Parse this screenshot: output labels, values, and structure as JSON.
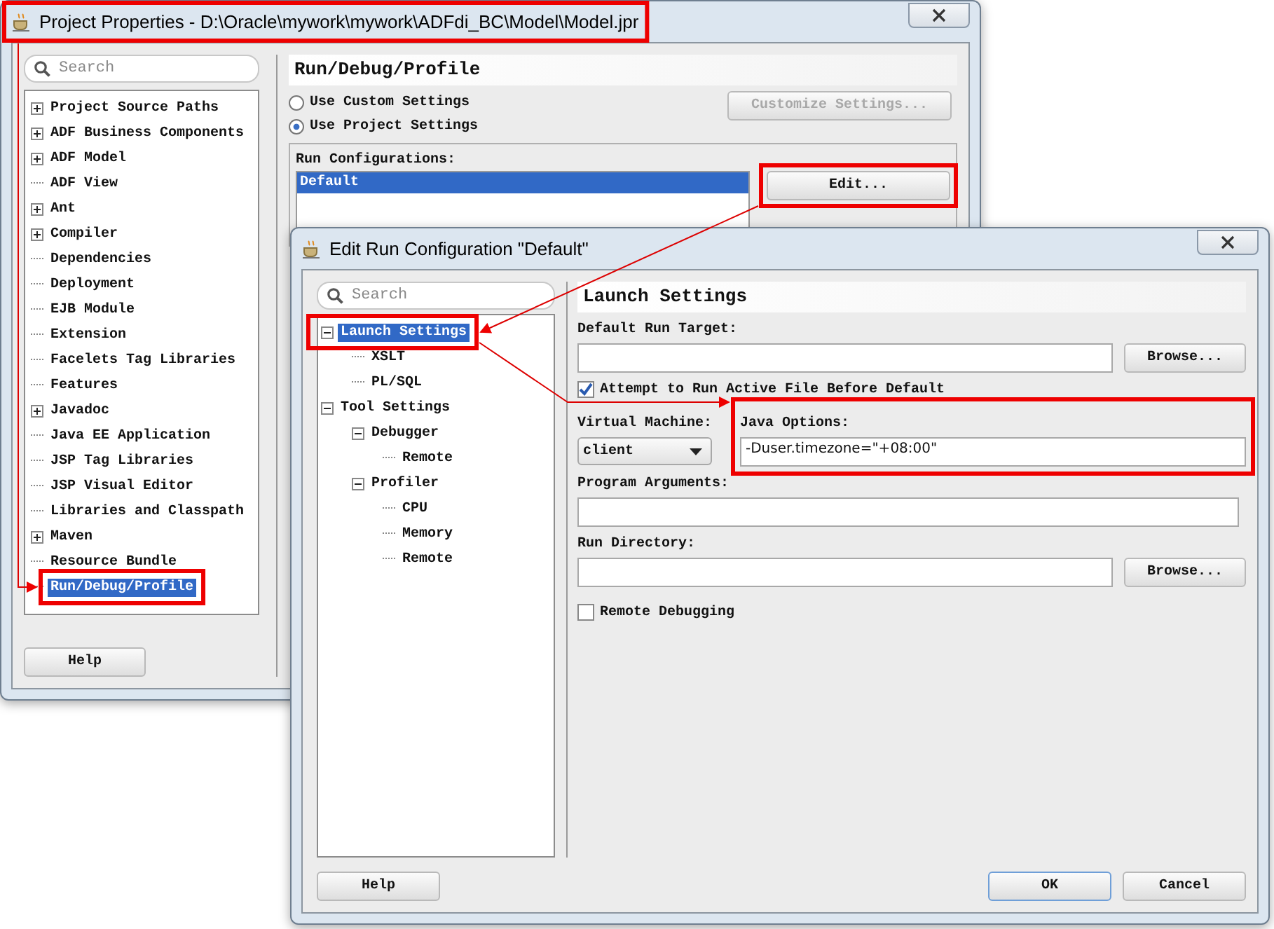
{
  "project_properties": {
    "title": "Project Properties - D:\\Oracle\\mywork\\mywork\\ADFdi_BC\\Model\\Model.jpr",
    "search": {
      "placeholder": "Search"
    },
    "tree": [
      {
        "label": "Project Source Paths",
        "expandable": true,
        "selected": false
      },
      {
        "label": "ADF Business Components",
        "expandable": true,
        "selected": false
      },
      {
        "label": "ADF Model",
        "expandable": true,
        "selected": false
      },
      {
        "label": "ADF View",
        "expandable": false,
        "selected": false
      },
      {
        "label": "Ant",
        "expandable": true,
        "selected": false
      },
      {
        "label": "Compiler",
        "expandable": true,
        "selected": false
      },
      {
        "label": "Dependencies",
        "expandable": false,
        "selected": false
      },
      {
        "label": "Deployment",
        "expandable": false,
        "selected": false
      },
      {
        "label": "EJB Module",
        "expandable": false,
        "selected": false
      },
      {
        "label": "Extension",
        "expandable": false,
        "selected": false
      },
      {
        "label": "Facelets Tag Libraries",
        "expandable": false,
        "selected": false
      },
      {
        "label": "Features",
        "expandable": false,
        "selected": false
      },
      {
        "label": "Javadoc",
        "expandable": true,
        "selected": false
      },
      {
        "label": "Java EE Application",
        "expandable": false,
        "selected": false
      },
      {
        "label": "JSP Tag Libraries",
        "expandable": false,
        "selected": false
      },
      {
        "label": "JSP Visual Editor",
        "expandable": false,
        "selected": false
      },
      {
        "label": "Libraries and Classpath",
        "expandable": false,
        "selected": false
      },
      {
        "label": "Maven",
        "expandable": true,
        "selected": false
      },
      {
        "label": "Resource Bundle",
        "expandable": false,
        "selected": false
      },
      {
        "label": "Run/Debug/Profile",
        "expandable": false,
        "selected": true
      }
    ],
    "help_button": "Help",
    "panel": {
      "heading": "Run/Debug/Profile",
      "options": [
        {
          "label": "Use Custom Settings",
          "selected": false
        },
        {
          "label": "Use Project Settings",
          "selected": true
        }
      ],
      "customize_button": {
        "label": "Customize Settings...",
        "disabled": true
      },
      "run_configurations": {
        "label": "Run Configurations:",
        "items": [
          {
            "label": "Default",
            "selected": true
          }
        ]
      },
      "edit_button": "Edit..."
    }
  },
  "edit_run_configuration": {
    "title": "Edit Run Configuration \"Default\"",
    "search": {
      "placeholder": "Search"
    },
    "tree": [
      {
        "label": "Launch Settings",
        "expanded": true,
        "selected": true,
        "children": [
          {
            "label": "XSLT",
            "selected": false
          },
          {
            "label": "PL/SQL",
            "selected": false
          }
        ]
      },
      {
        "label": "Tool Settings",
        "expanded": true,
        "selected": false,
        "children": [
          {
            "label": "Debugger",
            "expanded": true,
            "selected": false,
            "children": [
              {
                "label": "Remote",
                "selected": false
              }
            ]
          },
          {
            "label": "Profiler",
            "expanded": true,
            "selected": false,
            "children": [
              {
                "label": "CPU",
                "selected": false
              },
              {
                "label": "Memory",
                "selected": false
              },
              {
                "label": "Remote",
                "selected": false
              }
            ]
          }
        ]
      }
    ],
    "panel": {
      "heading": "Launch Settings",
      "default_run_target": {
        "label": "Default Run Target:",
        "browse_button": "Browse..."
      },
      "attempt_active_file": {
        "label": "Attempt to Run Active File Before Default",
        "checked": true
      },
      "virtual_machine": {
        "label": "Virtual Machine:",
        "value": "client"
      },
      "java_options": {
        "label": "Java Options:",
        "value": "-Duser.timezone=\"+08:00\""
      },
      "program_arguments": {
        "label": "Program Arguments:"
      },
      "run_directory": {
        "label": "Run Directory:",
        "browse_button": "Browse..."
      },
      "remote_debugging": {
        "label": "Remote Debugging",
        "checked": false
      }
    },
    "buttons": [
      {
        "label": "Help",
        "default": false
      },
      {
        "label": "OK",
        "default": true
      },
      {
        "label": "Cancel",
        "default": false
      }
    ]
  }
}
